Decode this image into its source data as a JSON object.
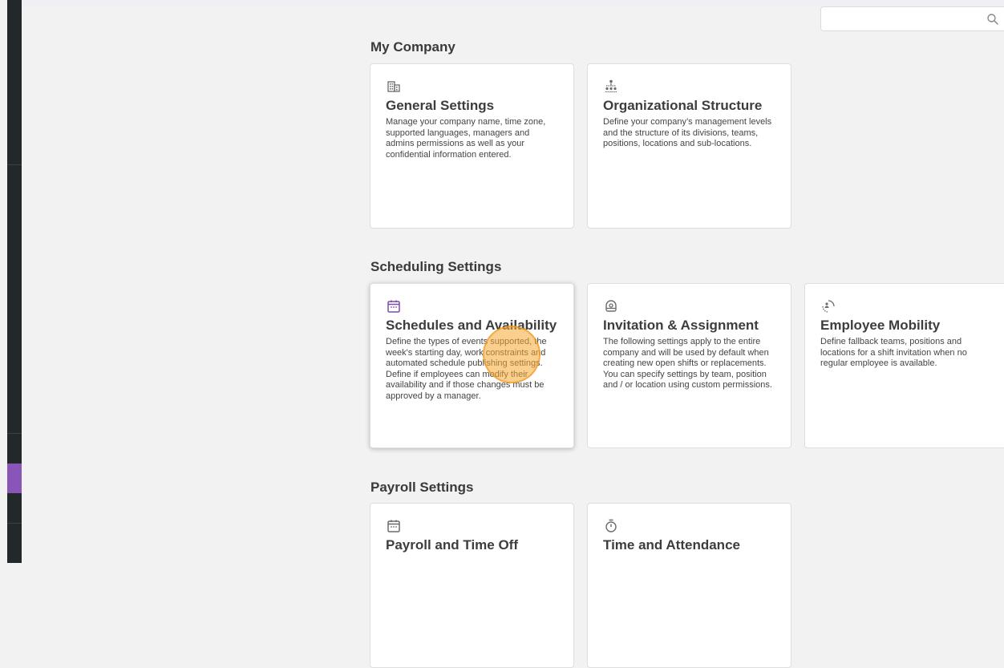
{
  "search": {
    "placeholder": "",
    "icon": "search-icon"
  },
  "sidebar": {
    "active_color": "#8a55b9"
  },
  "sections": {
    "my_company": {
      "title": "My Company",
      "cards": [
        {
          "icon": "building-icon",
          "title": "General Settings",
          "description": "Manage your company name, time zone, supported languages, managers and admins permissions as well as your confidential information entered."
        },
        {
          "icon": "org-chart-icon",
          "title": "Organizational Structure",
          "description": "Define your company’s management levels and the structure of its divisions, teams, positions, locations and sub-locations."
        }
      ]
    },
    "scheduling": {
      "title": "Scheduling Settings",
      "cards": [
        {
          "icon": "calendar-icon",
          "title": "Schedules and Availability",
          "description": "Define the types of events supported, the week's starting day, work constraints and automated schedule publishing settings. Define if employees can modify their availability and if those changes must be approved by a manager."
        },
        {
          "icon": "assignment-icon",
          "title": "Invitation & Assignment",
          "description": "The following settings apply to the entire company and will be used by default when creating new open shifts or replacements. You can specify settings by team, position and / or location using custom permissions."
        },
        {
          "icon": "mobility-icon",
          "title": "Employee Mobility",
          "description": "Define fallback teams, positions and locations for a shift invitation when no regular employee is available."
        }
      ]
    },
    "payroll": {
      "title": "Payroll Settings",
      "cards": [
        {
          "icon": "calendar-icon",
          "title": "Payroll and Time Off",
          "description": ""
        },
        {
          "icon": "stopwatch-icon",
          "title": "Time and Attendance",
          "description": ""
        }
      ]
    }
  }
}
